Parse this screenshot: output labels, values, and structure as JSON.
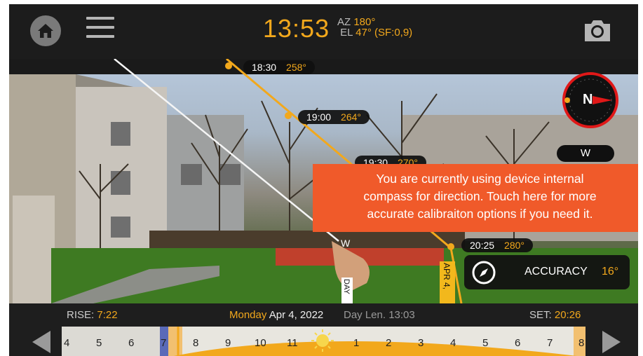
{
  "header": {
    "time": "13:53",
    "az_label": "AZ",
    "az_value": "180°",
    "el_label": "EL",
    "el_value": "47° (SF:0,9)"
  },
  "sun_path_labels": [
    {
      "time": "18:30",
      "deg": "258°"
    },
    {
      "time": "19:00",
      "deg": "264°"
    },
    {
      "time": "19:30",
      "deg": "270°"
    },
    {
      "time": "20:25",
      "deg": "280°"
    }
  ],
  "compass": {
    "direction": "W",
    "needle_letter": "N"
  },
  "notice": {
    "line1": "You are currently using device internal",
    "line2": "compass for direction. Touch here for more",
    "line3": "accurate calibraiton options if you need it."
  },
  "accuracy": {
    "label": "ACCURACY",
    "value": "16°"
  },
  "path_tags": {
    "date": "APR 4,",
    "day": "DAY",
    "w_marker": "W"
  },
  "info": {
    "rise_label": "RISE:",
    "rise_value": "7:22",
    "weekday": "Monday",
    "date": "Apr 4, 2022",
    "day_length": "Day Len. 13:03",
    "set_label": "SET:",
    "set_value": "20:26"
  },
  "timeline": {
    "ticks": [
      "4",
      "5",
      "6",
      "7",
      "8",
      "9",
      "10",
      "11",
      "1",
      "2",
      "3",
      "4",
      "5",
      "6",
      "7",
      "8"
    ]
  },
  "colors": {
    "accent": "#f2a81c",
    "notice": "#f05a2a",
    "compass_ring": "#e01818",
    "sun_path": "#f2a81c"
  }
}
